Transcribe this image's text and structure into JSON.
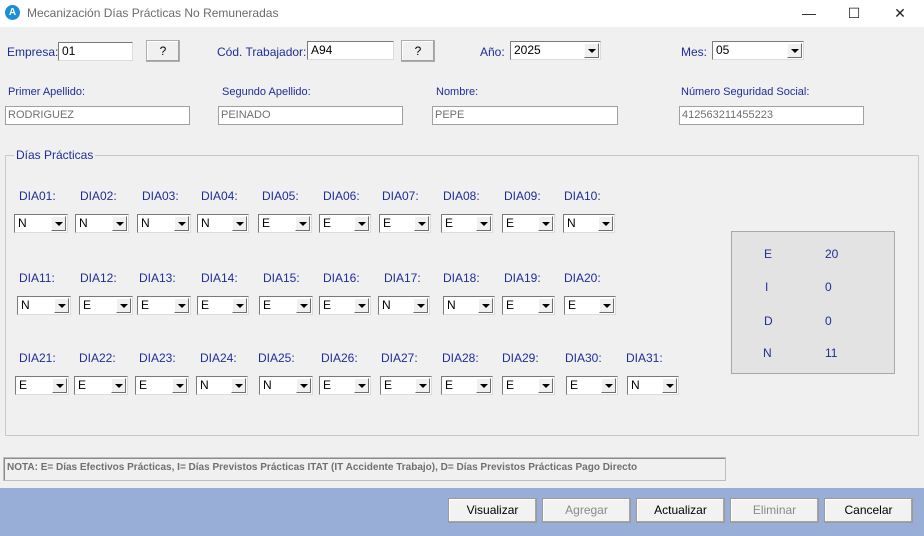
{
  "window": {
    "title": "Mecanización Días Prácticas No Remuneradas",
    "minimize": "—",
    "maximize": "☐",
    "close": "✕",
    "icon_letter": "A"
  },
  "header": {
    "empresa_label": "Empresa:",
    "empresa_value": "01",
    "empresa_lookup": "?",
    "cod_trabajador_label": "Cód. Trabajador:",
    "cod_trabajador_value": "A94",
    "cod_trabajador_lookup": "?",
    "anio_label": "Año:",
    "anio_value": "2025",
    "mes_label": "Mes:",
    "mes_value": "05"
  },
  "person": {
    "primer_apellido_label": "Primer Apellido:",
    "primer_apellido_value": "RODRIGUEZ",
    "segundo_apellido_label": "Segundo Apellido:",
    "segundo_apellido_value": "PEINADO",
    "nombre_label": "Nombre:",
    "nombre_value": "PEPE",
    "nss_label": "Número Seguridad Social:",
    "nss_value": "412563211455223"
  },
  "dias": {
    "group_title": "Días Prácticas",
    "days": [
      {
        "label": "DIA01:",
        "value": "N"
      },
      {
        "label": "DIA02:",
        "value": "N"
      },
      {
        "label": "DIA03:",
        "value": "N"
      },
      {
        "label": "DIA04:",
        "value": "N"
      },
      {
        "label": "DIA05:",
        "value": "E"
      },
      {
        "label": "DIA06:",
        "value": "E"
      },
      {
        "label": "DIA07:",
        "value": "E"
      },
      {
        "label": "DIA08:",
        "value": "E"
      },
      {
        "label": "DIA09:",
        "value": "E"
      },
      {
        "label": "DIA10:",
        "value": "N"
      },
      {
        "label": "DIA11:",
        "value": "N"
      },
      {
        "label": "DIA12:",
        "value": "E"
      },
      {
        "label": "DIA13:",
        "value": "E"
      },
      {
        "label": "DIA14:",
        "value": "E"
      },
      {
        "label": "DIA15:",
        "value": "E"
      },
      {
        "label": "DIA16:",
        "value": "E"
      },
      {
        "label": "DIA17:",
        "value": "N"
      },
      {
        "label": "DIA18:",
        "value": "N"
      },
      {
        "label": "DIA19:",
        "value": "E"
      },
      {
        "label": "DIA20:",
        "value": "E"
      },
      {
        "label": "DIA21:",
        "value": "E"
      },
      {
        "label": "DIA22:",
        "value": "E"
      },
      {
        "label": "DIA23:",
        "value": "E"
      },
      {
        "label": "DIA24:",
        "value": "N"
      },
      {
        "label": "DIA25:",
        "value": "N"
      },
      {
        "label": "DIA26:",
        "value": "E"
      },
      {
        "label": "DIA27:",
        "value": "E"
      },
      {
        "label": "DIA28:",
        "value": "E"
      },
      {
        "label": "DIA29:",
        "value": "E"
      },
      {
        "label": "DIA30:",
        "value": "E"
      },
      {
        "label": "DIA31:",
        "value": "N"
      }
    ]
  },
  "summary": [
    {
      "key": "E",
      "value": "20"
    },
    {
      "key": "I",
      "value": "0"
    },
    {
      "key": "D",
      "value": "0"
    },
    {
      "key": "N",
      "value": "11"
    }
  ],
  "note": "NOTA: E= Días Efectivos Prácticas,  I= Días Previstos  Prácticas ITAT (IT Accidente Trabajo),  D= Días Previstos Prácticas Pago Directo",
  "buttons": {
    "visualizar": "Visualizar",
    "agregar": "Agregar",
    "actualizar": "Actualizar",
    "eliminar": "Eliminar",
    "cancelar": "Cancelar"
  },
  "colors": {
    "label_blue": "#1f2d9a",
    "bottom_bar": "#98aed6",
    "window_bg": "#f0f0f0"
  }
}
